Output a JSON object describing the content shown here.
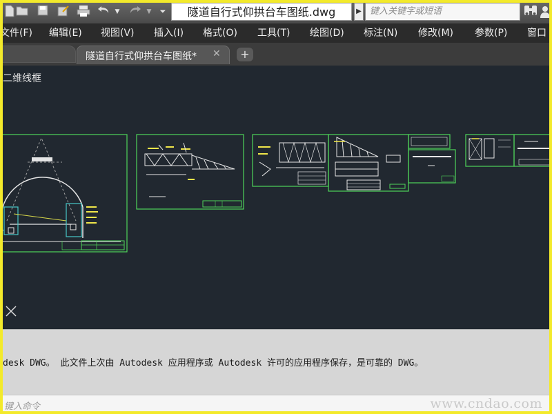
{
  "window": {
    "document_title": "隧道自行式仰拱台车图纸.dwg",
    "search_placeholder": "键入关键字或短语"
  },
  "menu": [
    {
      "id": "file",
      "label": "文件(F)"
    },
    {
      "id": "edit",
      "label": "编辑(E)"
    },
    {
      "id": "view",
      "label": "视图(V)"
    },
    {
      "id": "insert",
      "label": "插入(I)"
    },
    {
      "id": "format",
      "label": "格式(O)"
    },
    {
      "id": "tools",
      "label": "工具(T)"
    },
    {
      "id": "draw",
      "label": "绘图(D)"
    },
    {
      "id": "dimension",
      "label": "标注(N)"
    },
    {
      "id": "modify",
      "label": "修改(M)"
    },
    {
      "id": "parameters",
      "label": "参数(P)"
    },
    {
      "id": "window",
      "label": "窗口"
    }
  ],
  "tabs": {
    "active_label": "隧道自行式仰拱台车图纸*"
  },
  "canvas": {
    "view_label": "二维线框"
  },
  "command": {
    "history_line": "desk DWG。 此文件上次由 Autodesk 应用程序或 Autodesk 许可的应用程序保存，是可靠的 DWG。",
    "input_placeholder": "键入命令"
  },
  "watermark": "www.cndao.com",
  "colors": {
    "frame": "#f3ea2b",
    "canvas_bg": "#212830",
    "sheet_border": "#4fd65a",
    "drawing_lines": "#e6e6e6"
  }
}
